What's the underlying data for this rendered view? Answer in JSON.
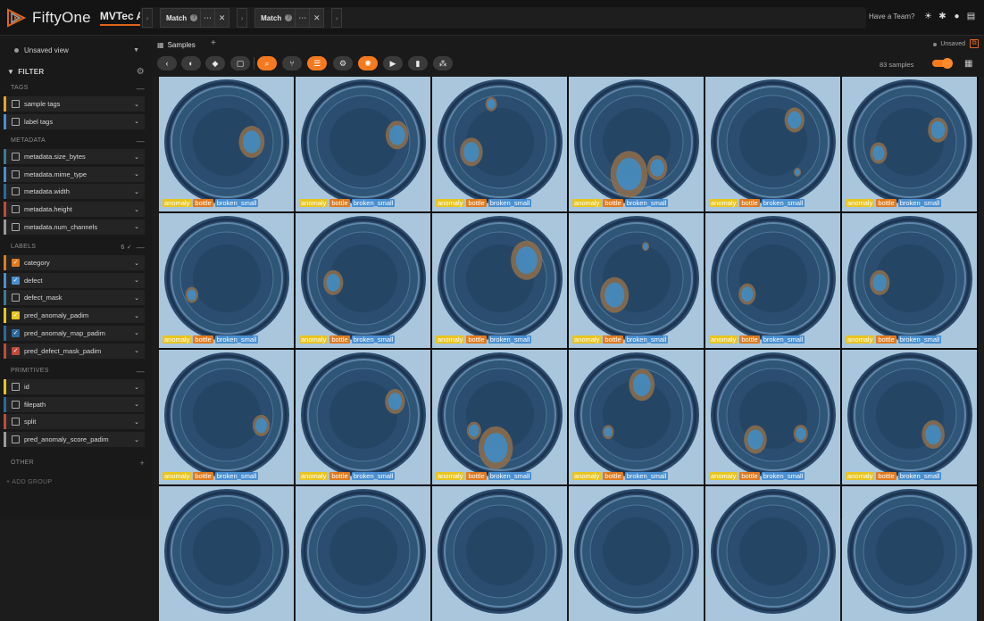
{
  "app": {
    "name": "FiftyOne",
    "dataset": "MVTec AD"
  },
  "stages": [
    {
      "label": "Match"
    },
    {
      "label": "Match"
    }
  ],
  "header": {
    "have_team": "Have a Team?"
  },
  "sidebar": {
    "view": "Unsaved view",
    "filter_label": "FILTER",
    "add_group": "+ ADD GROUP",
    "groups": [
      {
        "name": "TAGS",
        "ctl": "—",
        "fields": [
          {
            "name": "sample tags",
            "color": "#e8a428",
            "checked": false
          },
          {
            "name": "label tags",
            "color": "#4a8fd1",
            "checked": false
          }
        ]
      },
      {
        "name": "METADATA",
        "ctl": "—",
        "fields": [
          {
            "name": "metadata.size_bytes",
            "color": "#3c7a96",
            "checked": false
          },
          {
            "name": "metadata.mime_type",
            "color": "#4a8fd1",
            "checked": false
          },
          {
            "name": "metadata.width",
            "color": "#2a6a9e",
            "checked": false
          },
          {
            "name": "metadata.height",
            "color": "#c04a3a",
            "checked": false
          },
          {
            "name": "metadata.num_channels",
            "color": "#9a9a9a",
            "checked": false
          }
        ]
      },
      {
        "name": "LABELS",
        "ctl": "—",
        "count": "6 ✓",
        "fields": [
          {
            "name": "category",
            "color": "#e07a1f",
            "checked": true
          },
          {
            "name": "defect",
            "color": "#4a8fd1",
            "checked": true
          },
          {
            "name": "defect_mask",
            "color": "#3c7a96",
            "checked": false
          },
          {
            "name": "pred_anomaly_padim",
            "color": "#e8c520",
            "checked": true
          },
          {
            "name": "pred_anomaly_map_padim",
            "color": "#2a6a9e",
            "checked": true
          },
          {
            "name": "pred_defect_mask_padim",
            "color": "#c04a3a",
            "checked": true
          }
        ]
      },
      {
        "name": "PRIMITIVES",
        "ctl": "—",
        "fields": [
          {
            "name": "id",
            "color": "#e8c520",
            "checked": false
          },
          {
            "name": "filepath",
            "color": "#2a6a9e",
            "checked": false
          },
          {
            "name": "split",
            "color": "#c04a3a",
            "checked": false
          },
          {
            "name": "pred_anomaly_score_padim",
            "color": "#9a9a9a",
            "checked": false
          }
        ]
      },
      {
        "name": "OTHER",
        "ctl": "+",
        "fields": []
      }
    ]
  },
  "tabs": {
    "samples": "Samples",
    "unsaved": "Unsaved"
  },
  "toolbar": {
    "count": "83 samples"
  },
  "tags": [
    "anomaly",
    "bottle",
    "broken_small"
  ],
  "colors": {
    "accent": "#f57a1f",
    "anomaly": "#e8c520",
    "bottle": "#e07a1f",
    "defect": "#4a8fd1"
  }
}
